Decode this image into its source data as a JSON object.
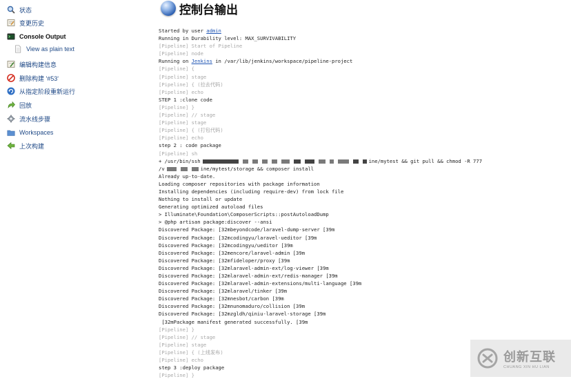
{
  "sidebar": {
    "items": [
      {
        "label": "状态",
        "icon": "magnifier-icon",
        "name": "sidebar-item-status"
      },
      {
        "label": "变更历史",
        "icon": "notepad-icon",
        "name": "sidebar-item-changes"
      },
      {
        "label": "Console Output",
        "icon": "terminal-icon",
        "name": "sidebar-item-console-output",
        "active": true
      },
      {
        "label": "View as plain text",
        "icon": "document-icon",
        "name": "sidebar-item-plain-text",
        "sub": true
      },
      {
        "label": "编辑构建信息",
        "icon": "notepad-edit-icon",
        "name": "sidebar-item-edit-build-info"
      },
      {
        "label": "删除构建 '#53'",
        "icon": "no-entry-icon",
        "name": "sidebar-item-delete-build"
      },
      {
        "label": "从指定阶段重新运行",
        "icon": "refresh-icon",
        "name": "sidebar-item-restart-stage"
      },
      {
        "label": "回放",
        "icon": "replay-arrow-icon",
        "name": "sidebar-item-replay"
      },
      {
        "label": "流水线步骤",
        "icon": "gear-icon",
        "name": "sidebar-item-pipeline-steps"
      },
      {
        "label": "Workspaces",
        "icon": "folder-icon",
        "name": "sidebar-item-workspaces"
      },
      {
        "label": "上次构建",
        "icon": "back-arrow-icon",
        "name": "sidebar-item-previous-build"
      }
    ]
  },
  "header": {
    "title": "控制台输出"
  },
  "console": {
    "lines": [
      {
        "t": "normal",
        "pre": "Started by user ",
        "link": "admin",
        "post": ""
      },
      {
        "t": "normal",
        "text": "Running in Durability level: MAX_SURVIVABILITY"
      },
      {
        "t": "pipe",
        "text": "[Pipeline] Start of Pipeline"
      },
      {
        "t": "pipe",
        "text": "[Pipeline] node"
      },
      {
        "t": "normal",
        "pre": "Running on ",
        "link": "Jenkins",
        "post": " in /var/lib/jenkins/workspace/pipeline-project"
      },
      {
        "t": "pipe",
        "text": "[Pipeline] {"
      },
      {
        "t": "pipe",
        "text": "[Pipeline] stage"
      },
      {
        "t": "pipe",
        "text": "[Pipeline] { (拉去代码)"
      },
      {
        "t": "pipe",
        "text": "[Pipeline] echo"
      },
      {
        "t": "normal",
        "text": "STEP 1 :clone code"
      },
      {
        "t": "pipe",
        "text": "[Pipeline] }"
      },
      {
        "t": "pipe",
        "text": "[Pipeline] // stage"
      },
      {
        "t": "pipe",
        "text": "[Pipeline] stage"
      },
      {
        "t": "pipe",
        "text": "[Pipeline] { (打包代码)"
      },
      {
        "t": "pipe",
        "text": "[Pipeline] echo"
      },
      {
        "t": "normal",
        "text": "step 2 : code package"
      },
      {
        "t": "pipe",
        "text": "[Pipeline] sh"
      },
      {
        "t": "redacted1",
        "pre": "+ /usr/bin/ssh",
        "post": "ine/mytest && git pull && chmod -R 777"
      },
      {
        "t": "redacted2",
        "pre": "/v",
        "post": "ine/mytest/storage && composer install"
      },
      {
        "t": "normal",
        "text": "Already up-to-date."
      },
      {
        "t": "normal",
        "text": "Loading composer repositories with package information"
      },
      {
        "t": "normal",
        "text": "Installing dependencies (including require-dev) from lock file"
      },
      {
        "t": "normal",
        "text": "Nothing to install or update"
      },
      {
        "t": "normal",
        "text": "Generating optimized autoload files"
      },
      {
        "t": "normal",
        "text": "> Illuminate\\Foundation\\ComposerScripts::postAutoloadDump"
      },
      {
        "t": "normal",
        "text": "> @php artisan package:discover --ansi"
      },
      {
        "t": "normal",
        "text": "Discovered Package: [32mbeyondcode/laravel-dump-server [39m"
      },
      {
        "t": "normal",
        "text": "Discovered Package: [32mcodingyu/laravel-ueditor [39m"
      },
      {
        "t": "normal",
        "text": "Discovered Package: [32mcodingyu/ueditor [39m"
      },
      {
        "t": "normal",
        "text": "Discovered Package: [32mencore/laravel-admin [39m"
      },
      {
        "t": "normal",
        "text": "Discovered Package: [32mfideloper/proxy [39m"
      },
      {
        "t": "normal",
        "text": "Discovered Package: [32mlaravel-admin-ext/log-viewer [39m"
      },
      {
        "t": "normal",
        "text": "Discovered Package: [32mlaravel-admin-ext/redis-manager [39m"
      },
      {
        "t": "normal",
        "text": "Discovered Package: [32mlaravel-admin-extensions/multi-language [39m"
      },
      {
        "t": "normal",
        "text": "Discovered Package: [32mlaravel/tinker [39m"
      },
      {
        "t": "normal",
        "text": "Discovered Package: [32mnesbot/carbon [39m"
      },
      {
        "t": "normal",
        "text": "Discovered Package: [32mnunomaduro/collision [39m"
      },
      {
        "t": "normal",
        "text": "Discovered Package: [32mzgldh/qiniu-laravel-storage [39m"
      },
      {
        "t": "normal",
        "text": " [32mPackage manifest generated successfully. [39m"
      },
      {
        "t": "pipe",
        "text": "[Pipeline] }"
      },
      {
        "t": "pipe",
        "text": "[Pipeline] // stage"
      },
      {
        "t": "pipe",
        "text": "[Pipeline] stage"
      },
      {
        "t": "pipe",
        "text": "[Pipeline] { (上线发布)"
      },
      {
        "t": "pipe",
        "text": "[Pipeline] echo"
      },
      {
        "t": "normal",
        "text": "step 3 :deploy package"
      },
      {
        "t": "pipe",
        "text": "[Pipeline] }"
      }
    ]
  },
  "watermark": {
    "cn": "创新互联",
    "en": "CHUANG XIN HU LIAN"
  }
}
